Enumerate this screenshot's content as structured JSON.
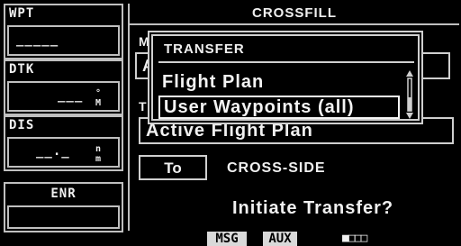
{
  "left_panel": {
    "wpt": {
      "label": "WPT",
      "value": "_____"
    },
    "dtk": {
      "label": "DTK",
      "value": "___",
      "unit": "°M"
    },
    "dis": {
      "label": "DIS",
      "value": "__._",
      "unit": "nm"
    },
    "mode": {
      "label": "ENR"
    }
  },
  "page": {
    "title": "CROSSFILL",
    "field1_hint": "M",
    "field1_value": "A",
    "field2_hint": "T",
    "field2_value": "Active Flight Plan",
    "to_button": "To",
    "cross_side_label": "CROSS-SIDE",
    "prompt": "Initiate Transfer?"
  },
  "popup": {
    "title": "TRANSFER",
    "items": [
      {
        "label": "Flight Plan",
        "selected": false
      },
      {
        "label": "User Waypoints (all)",
        "selected": true
      }
    ]
  },
  "bottom_bar": {
    "msg": "MSG",
    "aux": "AUX",
    "page_indicator": "■□□□"
  }
}
